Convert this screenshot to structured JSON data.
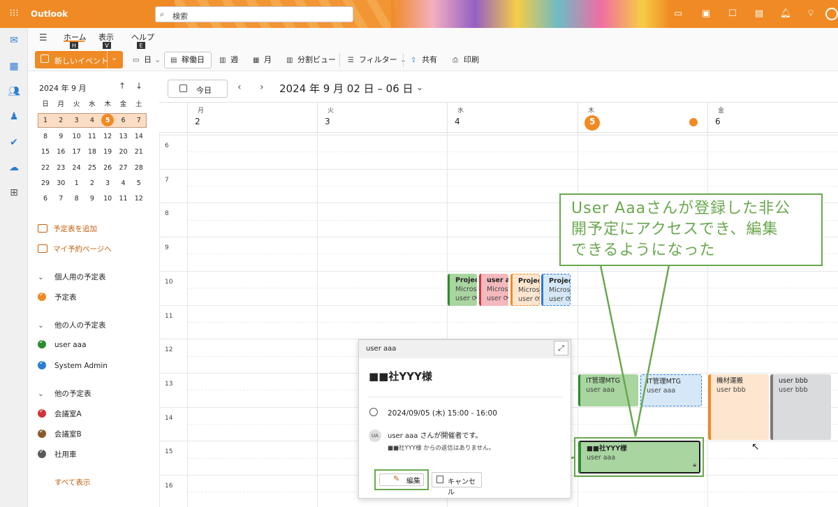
{
  "app": {
    "name": "Outlook"
  },
  "search": {
    "placeholder": "検索"
  },
  "ribbon": {
    "tabs": [
      {
        "label": "ホーム",
        "keytip": "H"
      },
      {
        "label": "表示",
        "keytip": "V"
      },
      {
        "label": "ヘルプ",
        "keytip": "E"
      }
    ],
    "new_event": "新しいイベント",
    "day": "日",
    "work_week": "稼働日",
    "week": "週",
    "month": "月",
    "split_view": "分割ビュー",
    "filter": "フィルター",
    "share": "共有",
    "print": "印刷"
  },
  "mini_calendar": {
    "title": "2024 年 9 月",
    "weekdays": [
      "日",
      "月",
      "火",
      "水",
      "木",
      "金",
      "土"
    ],
    "weeks": [
      [
        "1",
        "2",
        "3",
        "4",
        "5",
        "6",
        "7"
      ],
      [
        "8",
        "9",
        "10",
        "11",
        "12",
        "13",
        "14"
      ],
      [
        "15",
        "16",
        "17",
        "18",
        "19",
        "20",
        "21"
      ],
      [
        "22",
        "23",
        "24",
        "25",
        "26",
        "27",
        "28"
      ],
      [
        "29",
        "30",
        "1",
        "2",
        "3",
        "4",
        "5"
      ],
      [
        "6",
        "7",
        "8",
        "9",
        "10",
        "11",
        "12"
      ]
    ]
  },
  "sidebar": {
    "add_calendar": "予定表を追加",
    "booking_page": "マイ予約ページへ",
    "sections": [
      {
        "title": "個人用の予定表",
        "items": [
          {
            "label": "予定表",
            "color": "#f08a24"
          }
        ]
      },
      {
        "title": "他の人の予定表",
        "items": [
          {
            "label": "user aaa",
            "color": "#2e8b2e"
          },
          {
            "label": "System Admin",
            "color": "#2b7cd3"
          }
        ]
      },
      {
        "title": "他の予定表",
        "items": [
          {
            "label": "会議室A",
            "color": "#d13438"
          },
          {
            "label": "会議室B",
            "color": "#8a5a2b"
          },
          {
            "label": "社用車",
            "color": "#5a5a5a"
          }
        ]
      }
    ],
    "show_all": "すべて表示"
  },
  "calendar": {
    "today_button": "今日",
    "date_range": "2024 年 9 月 02 日 – 06 日",
    "days": [
      {
        "dow": "月",
        "num": "2"
      },
      {
        "dow": "火",
        "num": "3"
      },
      {
        "dow": "水",
        "num": "4"
      },
      {
        "dow": "木",
        "num": "5"
      },
      {
        "dow": "金",
        "num": "6"
      }
    ],
    "hours": [
      "6",
      "7",
      "8",
      "9",
      "10",
      "11",
      "12",
      "13",
      "14",
      "15",
      "16"
    ],
    "events": [
      {
        "title": "Project",
        "line2": "Micros",
        "line3": "user",
        "color": "#a8d5a0",
        "bar": "#2e8b2e"
      },
      {
        "title": "user a",
        "line2": "Micros",
        "line3": "user",
        "color": "#f4b9bd",
        "bar": "#d13438"
      },
      {
        "title": "Project",
        "line2": "Micros",
        "line3": "user",
        "color": "#fde6cf",
        "bar": "#f08a24"
      },
      {
        "title": "Project",
        "line2": "Micros",
        "line3": "user",
        "color": "#d6e8f7",
        "bar": "#2b7cd3"
      },
      {
        "title": "IT管理MTG",
        "line2": "user aaa",
        "color": "#a8d5a0",
        "bar": "#2e8b2e"
      },
      {
        "title": "IT管理MTG",
        "line2": "user aaa",
        "color": "#d6e8f7",
        "bar": "#2b7cd3"
      },
      {
        "title": "機材運搬",
        "line2": "user bbb",
        "color": "#fde6cf",
        "bar": "#f08a24"
      },
      {
        "title": "user bbb",
        "line2": "user bbb",
        "color": "#d9dbdd",
        "bar": "#7a7a7a"
      },
      {
        "title": "■■社YYY様",
        "line2": "user aaa",
        "color": "#a8d5a0",
        "bar": "#2e8b2e"
      }
    ]
  },
  "popup": {
    "owner": "user aaa",
    "title": "■■社YYY様",
    "time": "2024/09/05 (木) 15:00 - 16:00",
    "avatar": "UA",
    "organizer": "user aaa さんが開催者です。",
    "no_reply": "■■社YYY様 からの返信はありません。",
    "edit": "編集",
    "cancel": "キャンセル"
  },
  "callout": {
    "line1": "User Aaaさんが登録した非公",
    "line2": "開予定にアクセスでき、編集",
    "line3": "できるようになった"
  },
  "colors": {
    "accent": "#f08a24",
    "callout": "#6aa84f"
  }
}
